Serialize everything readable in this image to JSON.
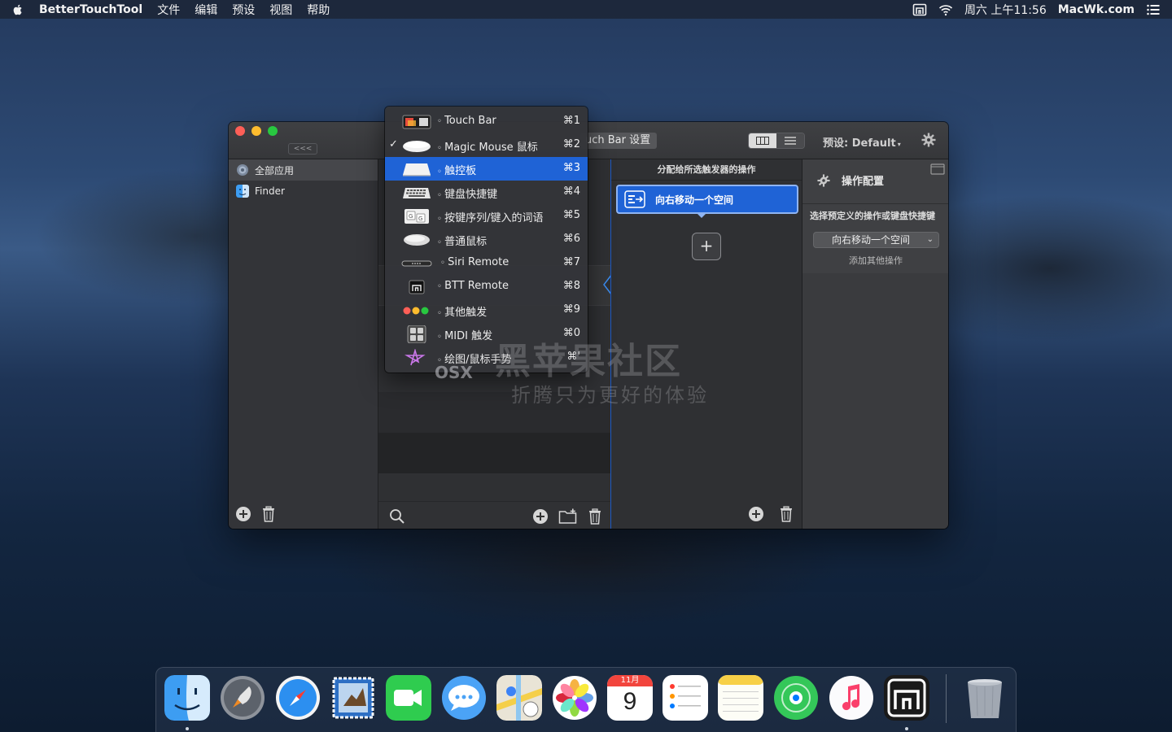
{
  "menubar": {
    "app_name": "BetterTouchTool",
    "menus": [
      "文件",
      "编辑",
      "预设",
      "视图",
      "帮助"
    ],
    "clock": "周六 上午11:56",
    "site": "MacWk.com"
  },
  "window": {
    "collapse_label": "<<<",
    "title_tab": "uch Bar 设置",
    "preset_label": "预设: Default",
    "preset_caret": "▾",
    "apps": [
      {
        "name": "全部应用",
        "selected": true
      },
      {
        "name": "Finder",
        "selected": false
      }
    ],
    "actions_header": "分配给所选触发器的操作",
    "action_item": "向右移动一个空间",
    "add_symbol": "+",
    "config": {
      "title": "操作配置",
      "label": "选择预定义的操作或键盘快捷键",
      "selected": "向右移动一个空间",
      "chevron": "⌄",
      "add_other": "添加其他操作"
    }
  },
  "dropdown": {
    "check": "✓",
    "items": [
      {
        "label": "Touch Bar",
        "key": "⌘1",
        "icon": "touchbar-icon",
        "checked": false,
        "highlighted": false
      },
      {
        "label": "Magic Mouse 鼠标",
        "key": "⌘2",
        "icon": "magic-mouse-icon",
        "checked": true,
        "highlighted": false
      },
      {
        "label": "触控板",
        "key": "⌘3",
        "icon": "trackpad-icon",
        "checked": false,
        "highlighted": true
      },
      {
        "label": "键盘快捷键",
        "key": "⌘4",
        "icon": "keyboard-icon",
        "checked": false,
        "highlighted": false
      },
      {
        "label": "按键序列/键入的词语",
        "key": "⌘5",
        "icon": "key-sequence-icon",
        "checked": false,
        "highlighted": false
      },
      {
        "label": "普通鼠标",
        "key": "⌘6",
        "icon": "normal-mouse-icon",
        "checked": false,
        "highlighted": false
      },
      {
        "label": "Siri Remote",
        "key": "⌘7",
        "icon": "siri-remote-icon",
        "checked": false,
        "highlighted": false
      },
      {
        "label": "BTT Remote",
        "key": "⌘8",
        "icon": "btt-remote-icon",
        "checked": false,
        "highlighted": false
      },
      {
        "label": "其他触发",
        "key": "⌘9",
        "icon": "other-triggers-icon",
        "checked": false,
        "highlighted": false
      },
      {
        "label": "MIDI 触发",
        "key": "⌘0",
        "icon": "midi-icon",
        "checked": false,
        "highlighted": false
      },
      {
        "label": "绘图/鼠标手势",
        "key": "⌘'",
        "icon": "drawing-gesture-icon",
        "checked": false,
        "highlighted": false
      }
    ]
  },
  "watermark": {
    "title": "黑苹果社区",
    "subtitle": "折腾只为更好的体验",
    "brand": "OSX"
  },
  "dock": {
    "calendar_month": "11月",
    "calendar_day": "9",
    "apps": [
      "finder-icon",
      "launchpad-icon",
      "safari-icon",
      "mail-icon",
      "facetime-icon",
      "messages-icon",
      "maps-icon",
      "photos-icon",
      "calendar-icon",
      "reminders-icon",
      "notes-icon",
      "find-my-icon",
      "music-icon",
      "bettertouchtool-icon",
      "trash-icon"
    ]
  },
  "colors": {
    "accent": "#1f63d6",
    "window_bg": "#2d2e31",
    "close": "#fe5f57",
    "minimize": "#febc2e",
    "maximize": "#28c840"
  }
}
